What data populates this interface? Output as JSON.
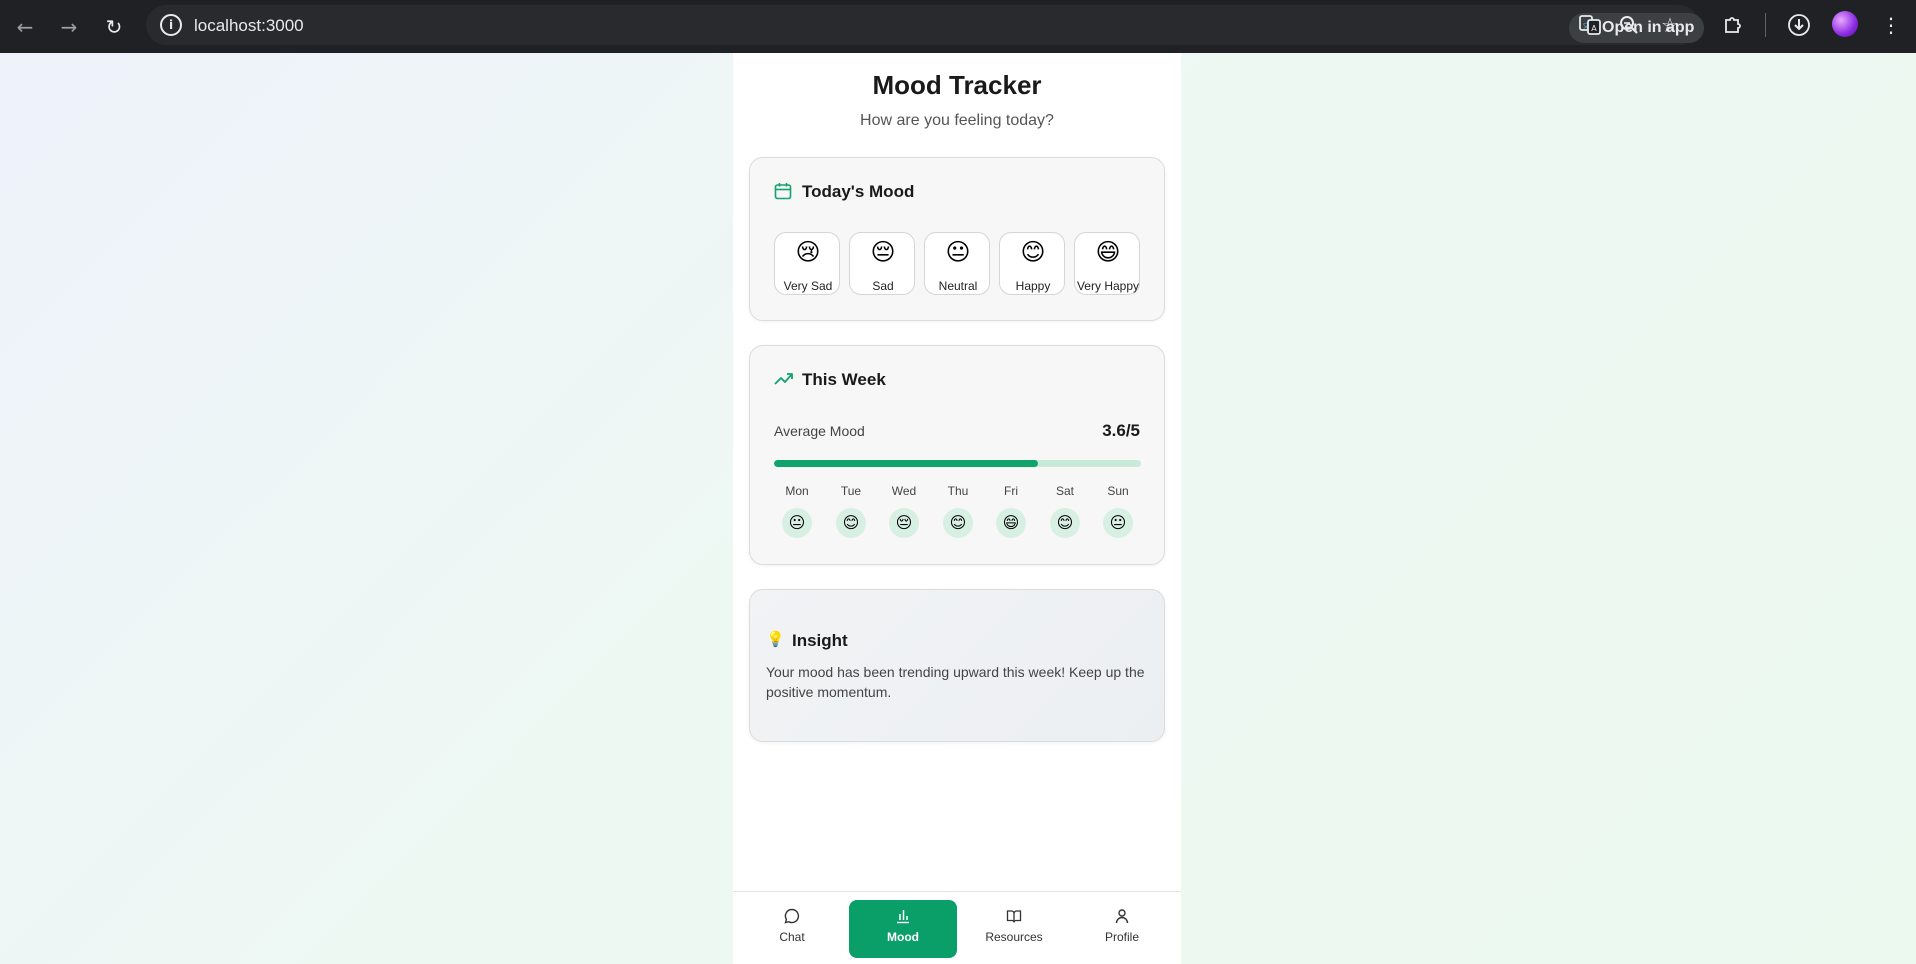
{
  "browser": {
    "url": "localhost:3000",
    "open_in_app": "Open in app",
    "icons": [
      "back-icon",
      "forward-icon",
      "reload-icon",
      "info-icon",
      "react-icon",
      "translate-icon",
      "zoom-icon",
      "star-icon",
      "extensions-icon",
      "download-icon",
      "profile-avatar",
      "more-icon"
    ]
  },
  "header": {
    "title": "Mood Tracker",
    "subtitle": "How are you feeling today?"
  },
  "today": {
    "title": "Today's Mood",
    "icon": "calendar-icon",
    "options": [
      {
        "emoji": "😢",
        "label": "Very Sad"
      },
      {
        "emoji": "😔",
        "label": "Sad"
      },
      {
        "emoji": "😐",
        "label": "Neutral"
      },
      {
        "emoji": "😊",
        "label": "Happy"
      },
      {
        "emoji": "😄",
        "label": "Very Happy"
      }
    ]
  },
  "week": {
    "title": "This Week",
    "icon": "trending-up-icon",
    "average_label": "Average Mood",
    "average_value": "3.6/5",
    "average_fraction": 0.72,
    "days": [
      {
        "name": "Mon",
        "emoji": "😐"
      },
      {
        "name": "Tue",
        "emoji": "😊"
      },
      {
        "name": "Wed",
        "emoji": "😔"
      },
      {
        "name": "Thu",
        "emoji": "😊"
      },
      {
        "name": "Fri",
        "emoji": "😄"
      },
      {
        "name": "Sat",
        "emoji": "😊"
      },
      {
        "name": "Sun",
        "emoji": "😐"
      }
    ]
  },
  "insight": {
    "icon_glyph": "💡",
    "title": "Insight",
    "text": "Your mood has been trending upward this week! Keep up the positive momentum."
  },
  "nav": {
    "items": [
      {
        "label": "Chat",
        "icon": "chat-icon",
        "active": false
      },
      {
        "label": "Mood",
        "icon": "bar-chart-icon",
        "active": true
      },
      {
        "label": "Resources",
        "icon": "book-icon",
        "active": false
      },
      {
        "label": "Profile",
        "icon": "user-icon",
        "active": false
      }
    ]
  },
  "colors": {
    "accent": "#0a9f69",
    "progress_track": "#c8eadb",
    "chrome": "#202124"
  }
}
